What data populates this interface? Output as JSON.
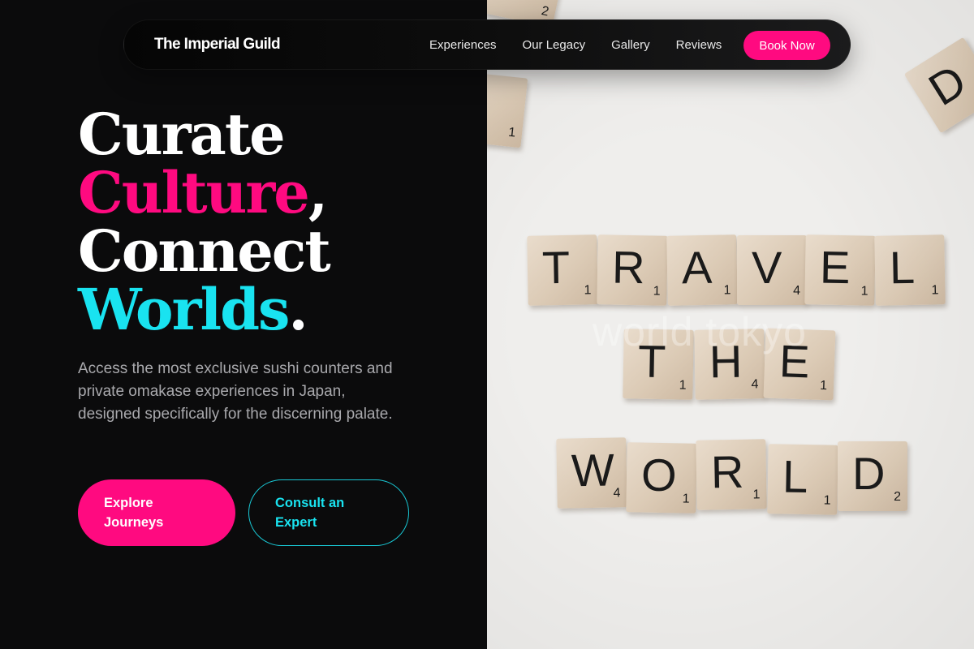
{
  "nav": {
    "brand": "The Imperial Guild",
    "links": [
      "Experiences",
      "Our Legacy",
      "Gallery",
      "Reviews"
    ],
    "cta": "Book Now"
  },
  "hero": {
    "line1": "Curate",
    "line2_word": "Culture",
    "line2_punct": ",",
    "line3": "Connect",
    "line4_word": "Worlds",
    "line4_punct": ".",
    "subtitle": "Access the most exclusive sushi counters and private omakase experiences in Japan, designed specifically for the discerning palate.",
    "primary_button": "Explore Journeys",
    "secondary_button": "Consult an Expert"
  },
  "image": {
    "watermark": "world tokyo",
    "row1": [
      {
        "l": "T",
        "s": "1"
      },
      {
        "l": "R",
        "s": "1"
      },
      {
        "l": "A",
        "s": "1"
      },
      {
        "l": "V",
        "s": "4"
      },
      {
        "l": "E",
        "s": "1"
      },
      {
        "l": "L",
        "s": "1"
      }
    ],
    "row2": [
      {
        "l": "T",
        "s": "1"
      },
      {
        "l": "H",
        "s": "4"
      },
      {
        "l": "E",
        "s": "1"
      }
    ],
    "row3": [
      {
        "l": "W",
        "s": "4"
      },
      {
        "l": "O",
        "s": "1"
      },
      {
        "l": "R",
        "s": "1"
      },
      {
        "l": "L",
        "s": "1"
      },
      {
        "l": "D",
        "s": "2"
      }
    ],
    "corner_top_right": {
      "l": "D",
      "s": ""
    },
    "corner_top_left": {
      "l": "",
      "s": "2"
    }
  },
  "colors": {
    "accent_pink": "#ff0a80",
    "accent_cyan": "#19e3f0",
    "background": "#0b0b0c"
  }
}
